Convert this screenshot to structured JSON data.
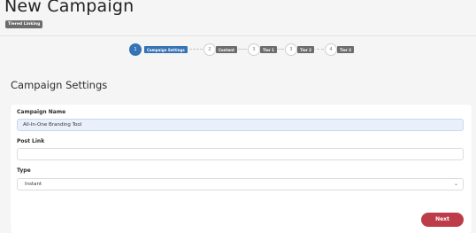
{
  "header": {
    "title": "New Campaign",
    "badge": "Tiered Linking"
  },
  "steps": [
    {
      "number": "1",
      "label": "Campaign Settings",
      "active": true
    },
    {
      "number": "2",
      "label": "Content",
      "active": false
    },
    {
      "number": "3",
      "label": "Tier 1",
      "active": false
    },
    {
      "number": "3",
      "label": "Tier 2",
      "active": false
    },
    {
      "number": "4",
      "label": "Tier 3",
      "active": false
    }
  ],
  "section": {
    "title": "Campaign Settings"
  },
  "form": {
    "campaign_name_label": "Campaign Name",
    "campaign_name_value": "All-In-One Branding Tool",
    "post_link_label": "Post Link",
    "post_link_value": "",
    "type_label": "Type",
    "type_value": "Instant",
    "next_label": "Next"
  },
  "colors": {
    "accent": "#3572b6",
    "primary_button": "#bd3c4a",
    "badge": "#6c6c6c"
  }
}
